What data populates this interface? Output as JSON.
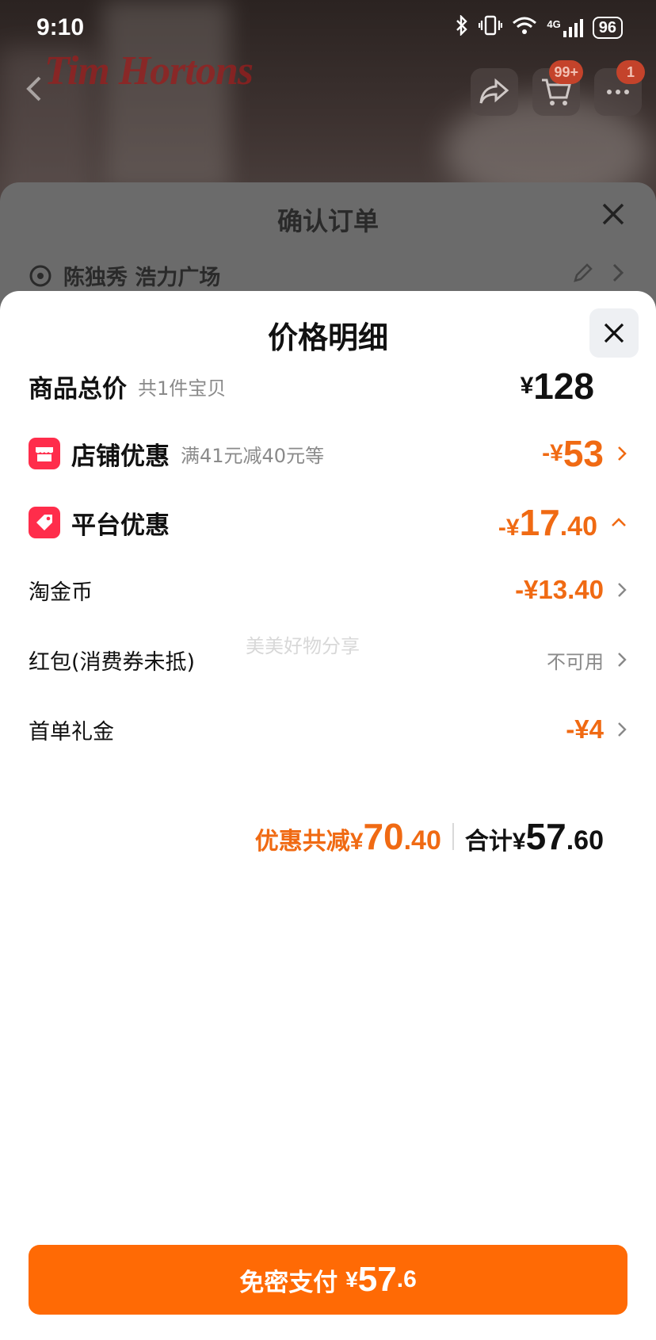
{
  "status_bar": {
    "time": "9:10",
    "battery": "96",
    "network": "4G"
  },
  "background": {
    "brand": "Tim Hortons",
    "cart_badge": "99+",
    "msg_badge": "1"
  },
  "confirm_order": {
    "title": "确认订单",
    "address": "陈独秀 浩力广场"
  },
  "price_detail": {
    "title": "价格明细",
    "goods_total": {
      "label": "商品总价",
      "sub": "共1件宝贝",
      "yen": "¥",
      "amount": "128"
    },
    "store_discount": {
      "label": "店铺优惠",
      "sub": "满41元减40元等",
      "sign": "-¥",
      "amount": "53"
    },
    "platform_discount": {
      "label": "平台优惠",
      "sign": "-¥",
      "int": "17",
      "dec": ".40"
    },
    "taojinbi": {
      "label": "淘金币",
      "amount": "-¥13.40"
    },
    "hongbao": {
      "label": "红包(消费券未抵)",
      "status": "不可用"
    },
    "first_order": {
      "label": "首单礼金",
      "amount": "-¥4"
    },
    "watermark": "美美好物分享",
    "summary": {
      "discount_label": "优惠共减",
      "discount_yen": "¥",
      "discount_int": "70",
      "discount_dec": ".40",
      "total_label": "合计",
      "total_yen": "¥",
      "total_int": "57",
      "total_dec": ".60"
    }
  },
  "pay_button": {
    "label": "免密支付",
    "yen": "¥",
    "int": "57",
    "dec": ".6"
  },
  "colors": {
    "accent": "#ff6a05",
    "discount": "#f06a13",
    "badge": "#ff2d4b"
  }
}
